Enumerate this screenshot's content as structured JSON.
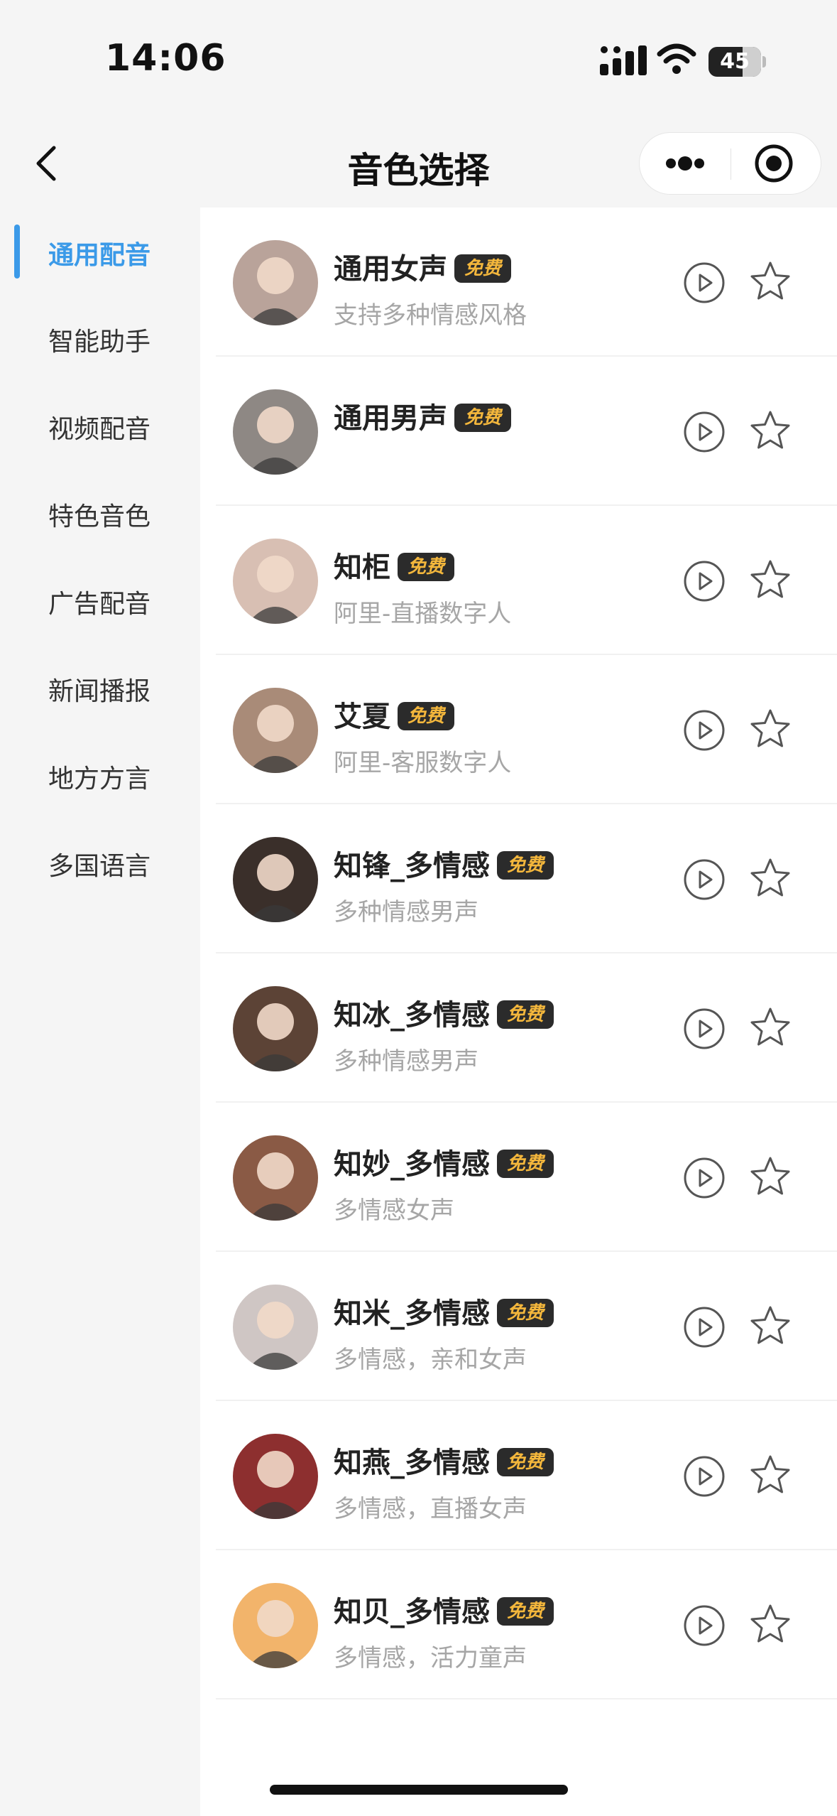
{
  "status_bar": {
    "time": "14:06",
    "battery_level": "45",
    "icons": [
      "signal-icon",
      "wifi-icon",
      "battery-icon"
    ]
  },
  "nav": {
    "title": "音色选择",
    "back_icon": "chevron-left-icon",
    "more_icon": "more-dots-icon",
    "close_icon": "target-circle-icon"
  },
  "sidebar": {
    "items": [
      {
        "label": "通用配音",
        "active": true
      },
      {
        "label": "智能助手",
        "active": false
      },
      {
        "label": "视频配音",
        "active": false
      },
      {
        "label": "特色音色",
        "active": false
      },
      {
        "label": "广告配音",
        "active": false
      },
      {
        "label": "新闻播报",
        "active": false
      },
      {
        "label": "地方方言",
        "active": false
      },
      {
        "label": "多国语言",
        "active": false
      }
    ]
  },
  "voices": [
    {
      "name": "通用女声",
      "badge": "免费",
      "desc": "支持多种情感风格",
      "avatar_color": "#b9a39a"
    },
    {
      "name": "通用男声",
      "badge": "免费",
      "desc": "",
      "avatar_color": "#8e8884"
    },
    {
      "name": "知柜",
      "badge": "免费",
      "desc": "阿里-直播数字人",
      "avatar_color": "#d8bfb3"
    },
    {
      "name": "艾夏",
      "badge": "免费",
      "desc": "阿里-客服数字人",
      "avatar_color": "#a98b78"
    },
    {
      "name": "知锋_多情感",
      "badge": "免费",
      "desc": "多种情感男声",
      "avatar_color": "#3a2f2a"
    },
    {
      "name": "知冰_多情感",
      "badge": "免费",
      "desc": "多种情感男声",
      "avatar_color": "#5c4336"
    },
    {
      "name": "知妙_多情感",
      "badge": "免费",
      "desc": "多情感女声",
      "avatar_color": "#8a5a45"
    },
    {
      "name": "知米_多情感",
      "badge": "免费",
      "desc": "多情感，亲和女声",
      "avatar_color": "#cfc6c4"
    },
    {
      "name": "知燕_多情感",
      "badge": "免费",
      "desc": "多情感，直播女声",
      "avatar_color": "#8d2f2f"
    },
    {
      "name": "知贝_多情感",
      "badge": "免费",
      "desc": "多情感，活力童声",
      "avatar_color": "#f2b46b"
    }
  ],
  "colors": {
    "accent": "#3b9ae8",
    "badge_bg": "#2b2b2b",
    "badge_text": "#f4b73c"
  }
}
